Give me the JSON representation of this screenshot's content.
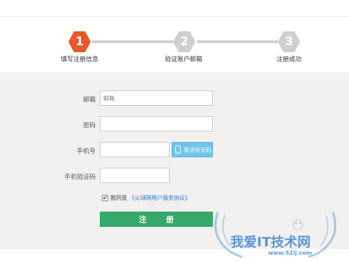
{
  "steps": [
    {
      "number": "1",
      "label": "填写注册信息",
      "state": "active",
      "color": "#e8582a"
    },
    {
      "number": "2",
      "label": "验证账户邮箱",
      "state": "pending",
      "color": "#cfcfcf"
    },
    {
      "number": "3",
      "label": "注册成功",
      "state": "pending",
      "color": "#cfcfcf"
    }
  ],
  "form": {
    "email_label": "邮箱",
    "email_placeholder": "邮箱",
    "password_label": "密码",
    "phone_label": "手机号",
    "sms_button": "发送验证码",
    "sms_code_label": "手机验证码",
    "agree_checked": true,
    "agree_text": "我同意",
    "agree_link": "《火球网用户服务协议》",
    "register_button": "注册"
  },
  "watermark": {
    "title": "我爱IT技术网",
    "url": "www.52ij.com"
  },
  "colors": {
    "accent_orange": "#e8582a",
    "inactive_gray": "#cfcfcf",
    "register_green": "#35a86a",
    "sms_blue": "#6ec4ec",
    "link_blue": "#2b74c8"
  }
}
